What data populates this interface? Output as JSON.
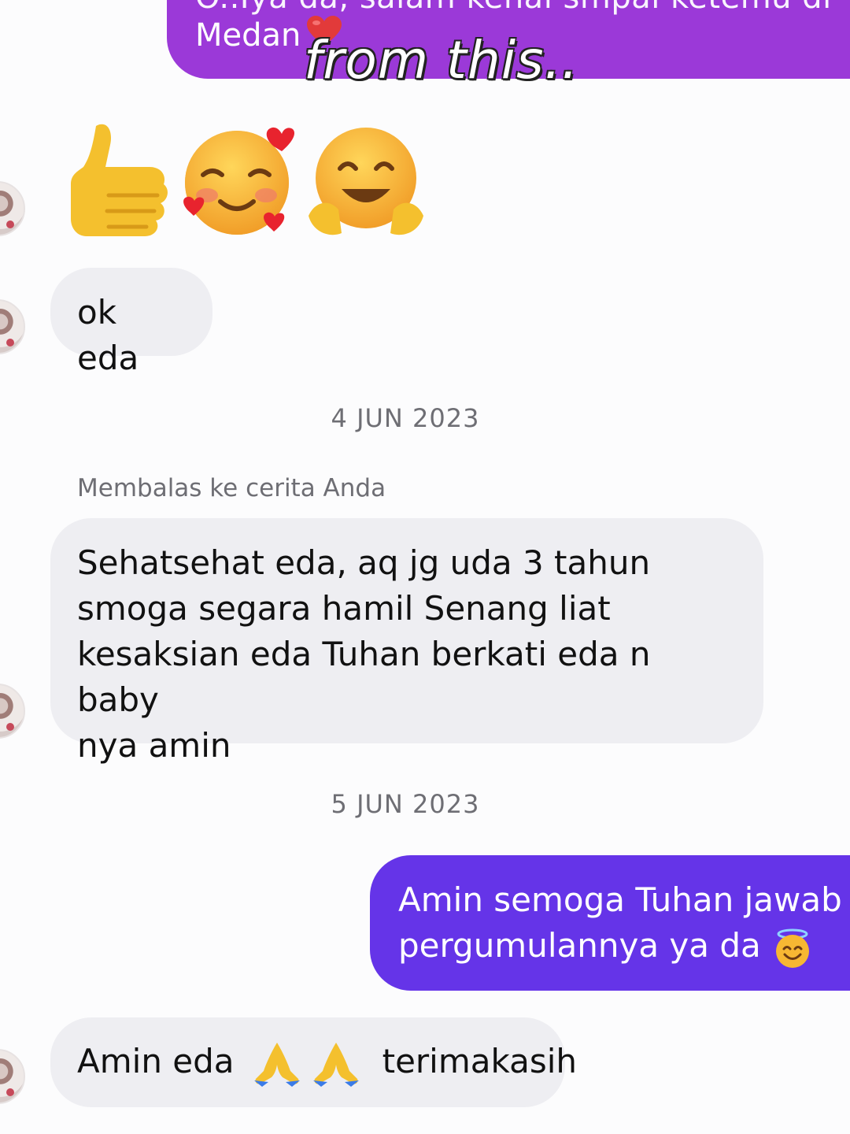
{
  "top_outgoing": {
    "partial_line": "O..Iya da, salam kenal smpai ketemu di",
    "line2": "Medan"
  },
  "video_caption": "from this..",
  "emoji_message": {
    "emojis": [
      "thumbs-up",
      "smiling-face-with-hearts",
      "hugging-face"
    ]
  },
  "messages": {
    "ok_eda": "ok eda",
    "date_1": "4 JUN 2023",
    "reply_label": "Membalas ke cerita Anda",
    "long_line1": "Sehatsehat eda, aq jg uda 3 tahun",
    "long_line2": "smoga segara hamil Senang liat",
    "long_line3": "kesaksian eda Tuhan berkati eda n baby",
    "long_line4": "nya amin",
    "date_2": "5 JUN 2023",
    "out_line1": "Amin semoga Tuhan jawab",
    "out_line2": "pergumulannya ya da",
    "amin_prefix": "Amin eda",
    "amin_suffix": "terimakasih"
  },
  "colors": {
    "outgoing_purple_top": "#9b39d8",
    "outgoing_purple": "#6534e8",
    "incoming_bubble": "#eeeef2",
    "background": "#fcfcfd"
  }
}
